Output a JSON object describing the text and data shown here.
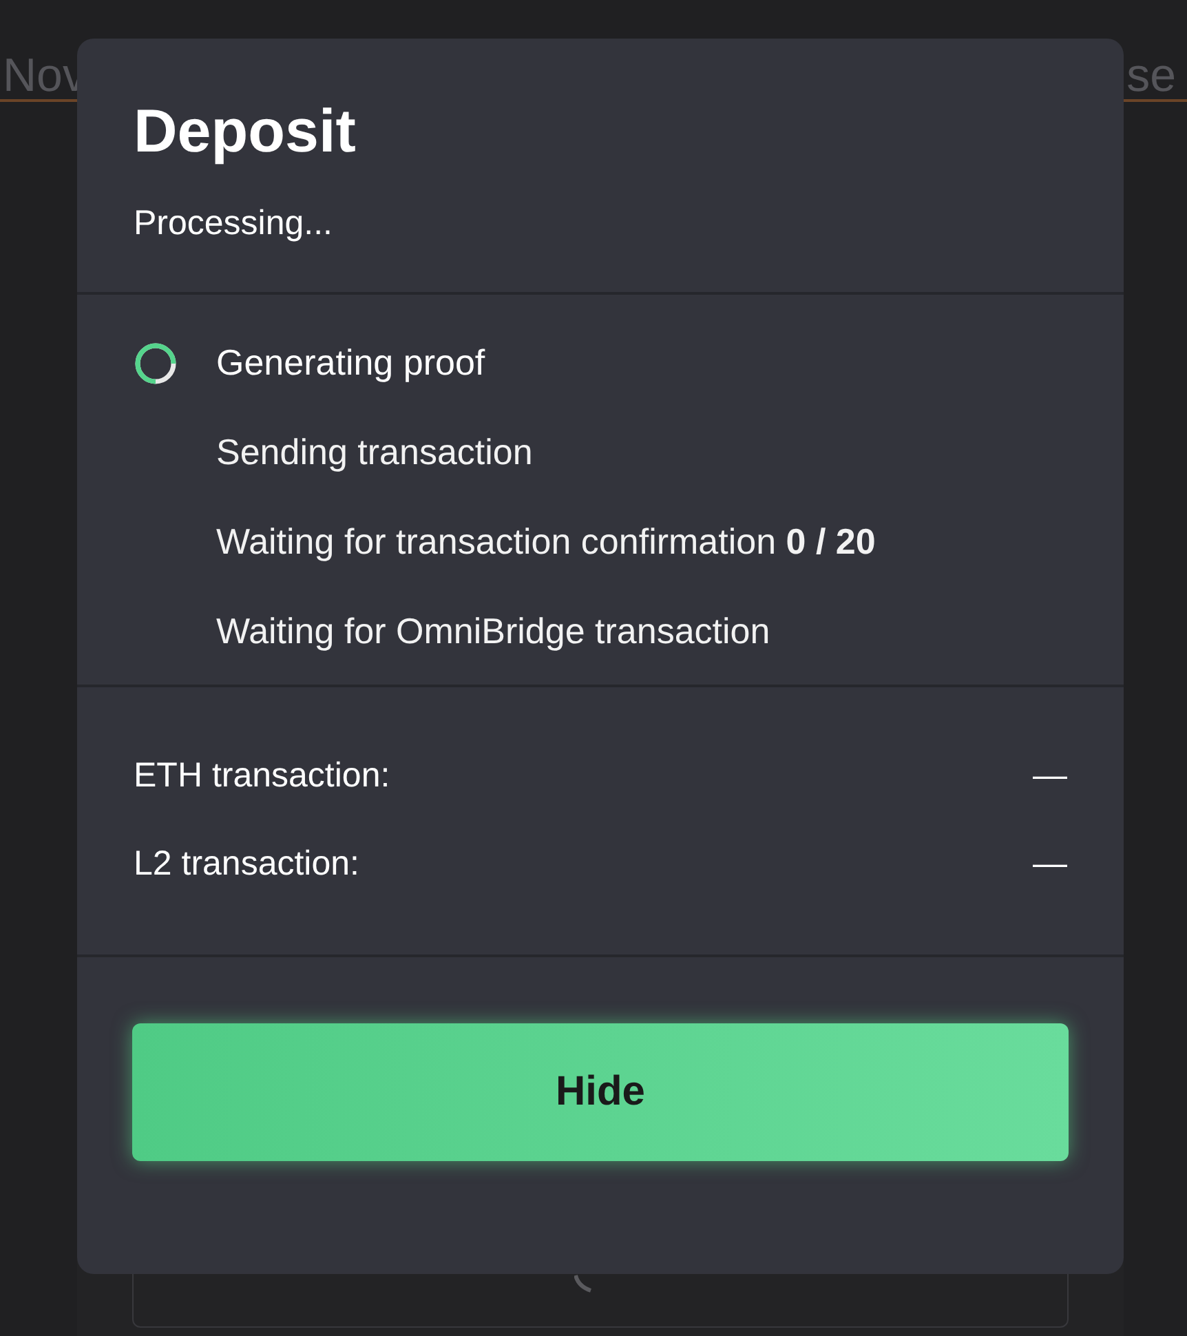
{
  "background": {
    "banner_left": "Nov",
    "banner_right": "se"
  },
  "modal": {
    "title": "Deposit",
    "subtitle": "Processing...",
    "steps": [
      {
        "label": "Generating proof",
        "in_progress": true
      },
      {
        "label": "Sending transaction",
        "in_progress": false
      },
      {
        "label": "Waiting for transaction confirmation **0 / 20**",
        "in_progress": false
      },
      {
        "label": "Waiting for OmniBridge transaction",
        "in_progress": false
      }
    ],
    "transactions": [
      {
        "label": "ETH transaction:",
        "value": "—"
      },
      {
        "label": "L2 transaction:",
        "value": "—"
      }
    ],
    "button": "Hide"
  }
}
